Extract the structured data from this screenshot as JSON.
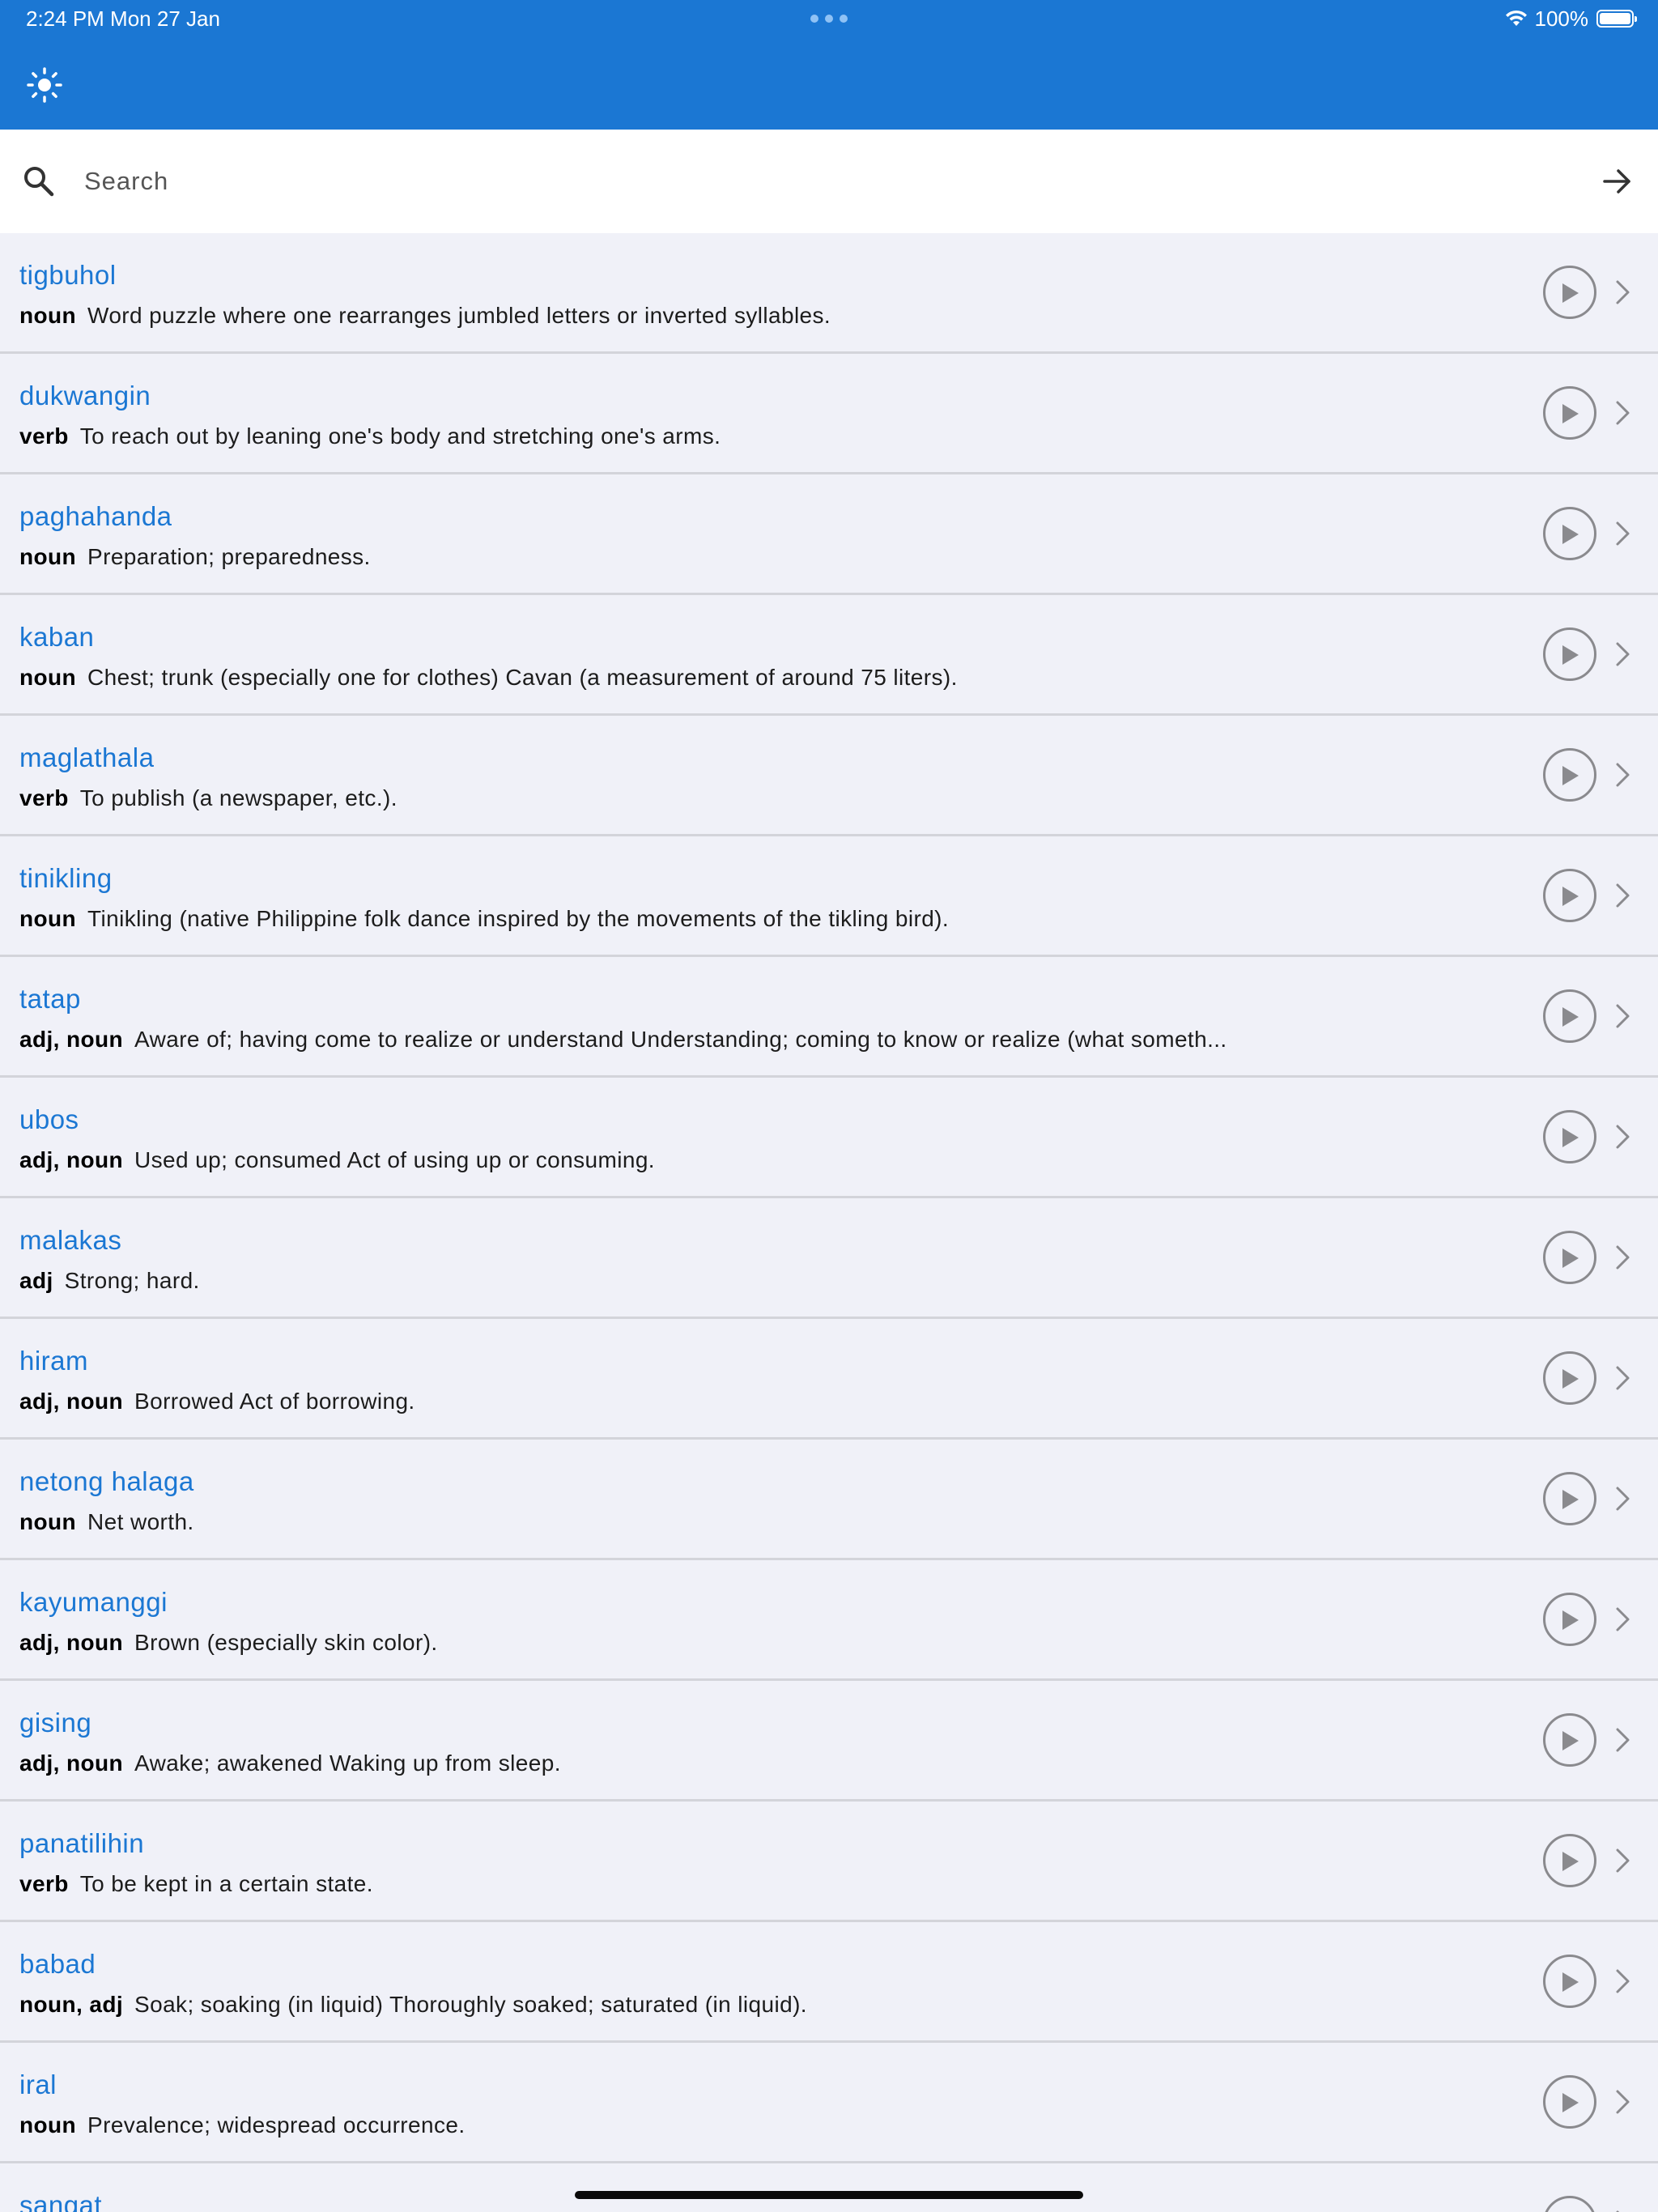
{
  "status_bar": {
    "time": "2:24 PM  Mon 27 Jan",
    "battery": "100%"
  },
  "search": {
    "placeholder": "Search"
  },
  "entries": [
    {
      "word": "tigbuhol",
      "pos": "noun",
      "definition": "Word puzzle where one rearranges jumbled letters or inverted syllables."
    },
    {
      "word": "dukwangin",
      "pos": "verb",
      "definition": "To reach out by leaning one's body and stretching one's arms."
    },
    {
      "word": "paghahanda",
      "pos": "noun",
      "definition": "Preparation; preparedness."
    },
    {
      "word": "kaban",
      "pos": "noun",
      "definition": "Chest; trunk (especially one for clothes) Cavan (a measurement of around 75 liters)."
    },
    {
      "word": "maglathala",
      "pos": "verb",
      "definition": "To publish (a newspaper, etc.)."
    },
    {
      "word": "tinikling",
      "pos": "noun",
      "definition": "Tinikling (native Philippine folk dance inspired by the movements of the tikling bird)."
    },
    {
      "word": "tatap",
      "pos": "adj, noun",
      "definition": "Aware of; having come to realize or understand Understanding; coming to know or realize (what someth..."
    },
    {
      "word": "ubos",
      "pos": "adj, noun",
      "definition": "Used up; consumed Act of using up or consuming."
    },
    {
      "word": "malakas",
      "pos": "adj",
      "definition": "Strong; hard."
    },
    {
      "word": "hiram",
      "pos": "adj, noun",
      "definition": "Borrowed Act of borrowing."
    },
    {
      "word": "netong halaga",
      "pos": "noun",
      "definition": "Net worth."
    },
    {
      "word": "kayumanggi",
      "pos": "adj, noun",
      "definition": "Brown (especially skin color)."
    },
    {
      "word": "gising",
      "pos": "adj, noun",
      "definition": "Awake; awakened Waking up from sleep."
    },
    {
      "word": "panatilihin",
      "pos": "verb",
      "definition": "To be kept in a certain state."
    },
    {
      "word": "babad",
      "pos": "noun, adj",
      "definition": "Soak; soaking (in liquid) Thoroughly soaked; saturated (in liquid)."
    },
    {
      "word": "iral",
      "pos": "noun",
      "definition": "Prevalence; widespread occurrence."
    },
    {
      "word": "sangat",
      "pos": "",
      "definition": ""
    }
  ],
  "colors": {
    "accent": "#1b77d3",
    "background": "#f0f1f8",
    "divider": "#d3d4da"
  }
}
